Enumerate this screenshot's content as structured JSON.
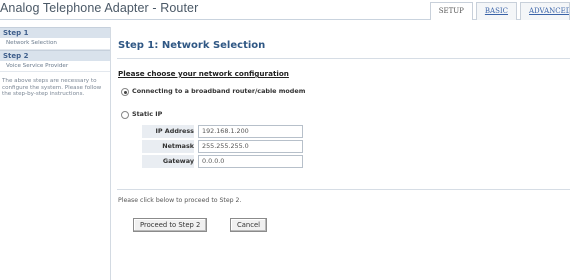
{
  "header": {
    "title": "Analog Telephone Adapter - Router",
    "tabs": [
      {
        "label": "SETUP"
      },
      {
        "label": "BASIC"
      },
      {
        "label": "ADVANCED"
      }
    ]
  },
  "sidebar": {
    "steps": [
      {
        "head": "Step 1",
        "item": "Network Selection"
      },
      {
        "head": "Step 2",
        "item": "Voice Service Provider"
      }
    ],
    "note": "The above steps are necessary to configure the system. Please follow the step-by-step instructions."
  },
  "main": {
    "title": "Step 1: Network Selection",
    "section_heading": "Please choose your network configuration",
    "options": [
      {
        "label": "Connecting to a broadband router/cable modem",
        "selected": true
      },
      {
        "label": "Static IP",
        "selected": false
      }
    ],
    "static_ip": {
      "fields": [
        {
          "label": "IP Address",
          "value": "192.168.1.200"
        },
        {
          "label": "Netmask",
          "value": "255.255.255.0"
        },
        {
          "label": "Gateway",
          "value": "0.0.0.0"
        }
      ]
    },
    "instruction": "Please click below to proceed to Step 2.",
    "buttons": {
      "proceed": "Proceed to Step 2",
      "cancel": "Cancel"
    }
  }
}
